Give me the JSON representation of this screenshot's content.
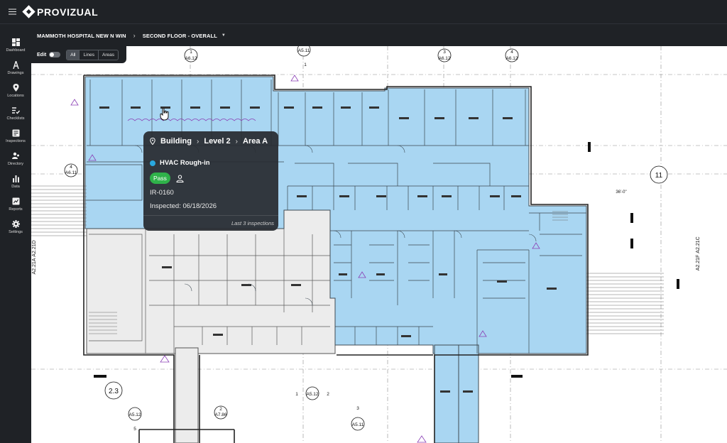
{
  "app": {
    "name": "PROVIZUAL"
  },
  "sidebar": {
    "items": [
      {
        "label": "Dashboard",
        "icon": "dashboard-icon"
      },
      {
        "label": "Drawings",
        "icon": "drawings-icon"
      },
      {
        "label": "Locations",
        "icon": "location-pin-icon"
      },
      {
        "label": "Checklists",
        "icon": "checklist-icon"
      },
      {
        "label": "Inspections",
        "icon": "inspections-icon"
      },
      {
        "label": "Directory",
        "icon": "directory-icon"
      },
      {
        "label": "Data",
        "icon": "bar-chart-icon"
      },
      {
        "label": "Reports",
        "icon": "reports-icon"
      },
      {
        "label": "Settings",
        "icon": "gear-icon"
      }
    ]
  },
  "breadcrumb": {
    "project": "MAMMOTH HOSPITAL NEW N WIN",
    "drawing": "SECOND FLOOR - OVERALL"
  },
  "toolbar": {
    "edit_label": "Edit",
    "filters": [
      "All",
      "Lines",
      "Areas"
    ],
    "active_filter": "All"
  },
  "plan_labels": {
    "tags": [
      "A5.11",
      "1",
      "A6.12",
      "2",
      "3",
      "4",
      "A6.11",
      "11",
      "2.3",
      "A5.12",
      "5",
      "A7.86",
      "A5.12",
      "A5.11",
      "A2.21D",
      "A2.21A",
      "A2.21F",
      "A2.21C",
      "36'-0\""
    ]
  },
  "tooltip": {
    "location": [
      "Building",
      "Level 2",
      "Area A"
    ],
    "title": "HVAC Rough-in",
    "status": "Pass",
    "id": "IR-0160",
    "inspected": "Inspected: 06/18/2026",
    "footer": "Last 3 inspections"
  },
  "colors": {
    "area_fill": "#a9d6f2",
    "accent": "#29a8e0",
    "pass": "#2fb24a",
    "chrome": "#1f2226"
  }
}
